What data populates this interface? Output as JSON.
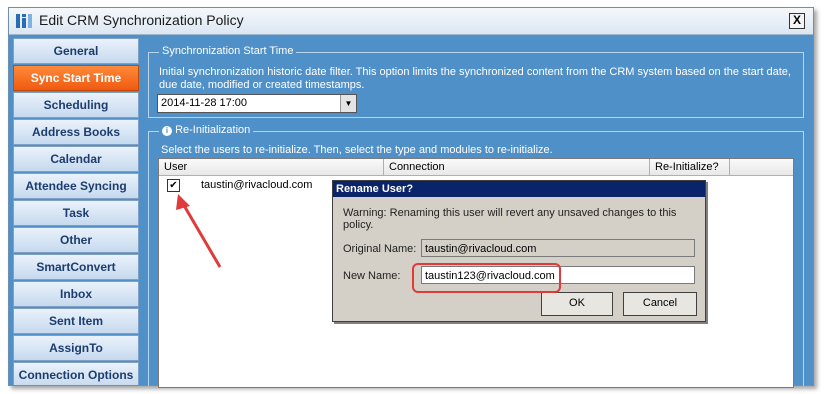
{
  "window": {
    "title": "Edit  CRM Synchronization Policy",
    "close_label": "X"
  },
  "sidebar": {
    "items": [
      {
        "label": "General",
        "active": false
      },
      {
        "label": "Sync Start Time",
        "active": true
      },
      {
        "label": "Scheduling",
        "active": false
      },
      {
        "label": "Address Books",
        "active": false
      },
      {
        "label": "Calendar",
        "active": false
      },
      {
        "label": "Attendee Syncing",
        "active": false
      },
      {
        "label": "Task",
        "active": false
      },
      {
        "label": "Other",
        "active": false
      },
      {
        "label": "SmartConvert",
        "active": false
      },
      {
        "label": "Inbox",
        "active": false
      },
      {
        "label": "Sent Item",
        "active": false
      },
      {
        "label": "AssignTo",
        "active": false
      },
      {
        "label": "Connection Options",
        "active": false
      }
    ]
  },
  "sync_start": {
    "title": "Synchronization Start Time",
    "desc1": "Initial synchronization historic date filter.  This option limits the synchronized content from the CRM system based on the start date,",
    "desc2": "due date, modified or created timestamps.",
    "date_value": "2014-11-28 17:00"
  },
  "reinit": {
    "title": "Re-Initialization",
    "desc": "Select the users to re-initialize.  Then, select the type and modules to re-initialize.",
    "columns": [
      "User",
      "Connection",
      "Re-Initialize?"
    ],
    "rows": [
      {
        "checked": true,
        "user": "taustin@rivacloud.com"
      }
    ]
  },
  "dialog": {
    "title": "Rename User?",
    "warning": "Warning: Renaming this user will revert any unsaved changes to this policy.",
    "original_label": "Original Name:",
    "original_value": "taustin@rivacloud.com",
    "new_label": "New Name:",
    "new_value": "taustin123@rivacloud.com",
    "ok_label": "OK",
    "cancel_label": "Cancel"
  }
}
